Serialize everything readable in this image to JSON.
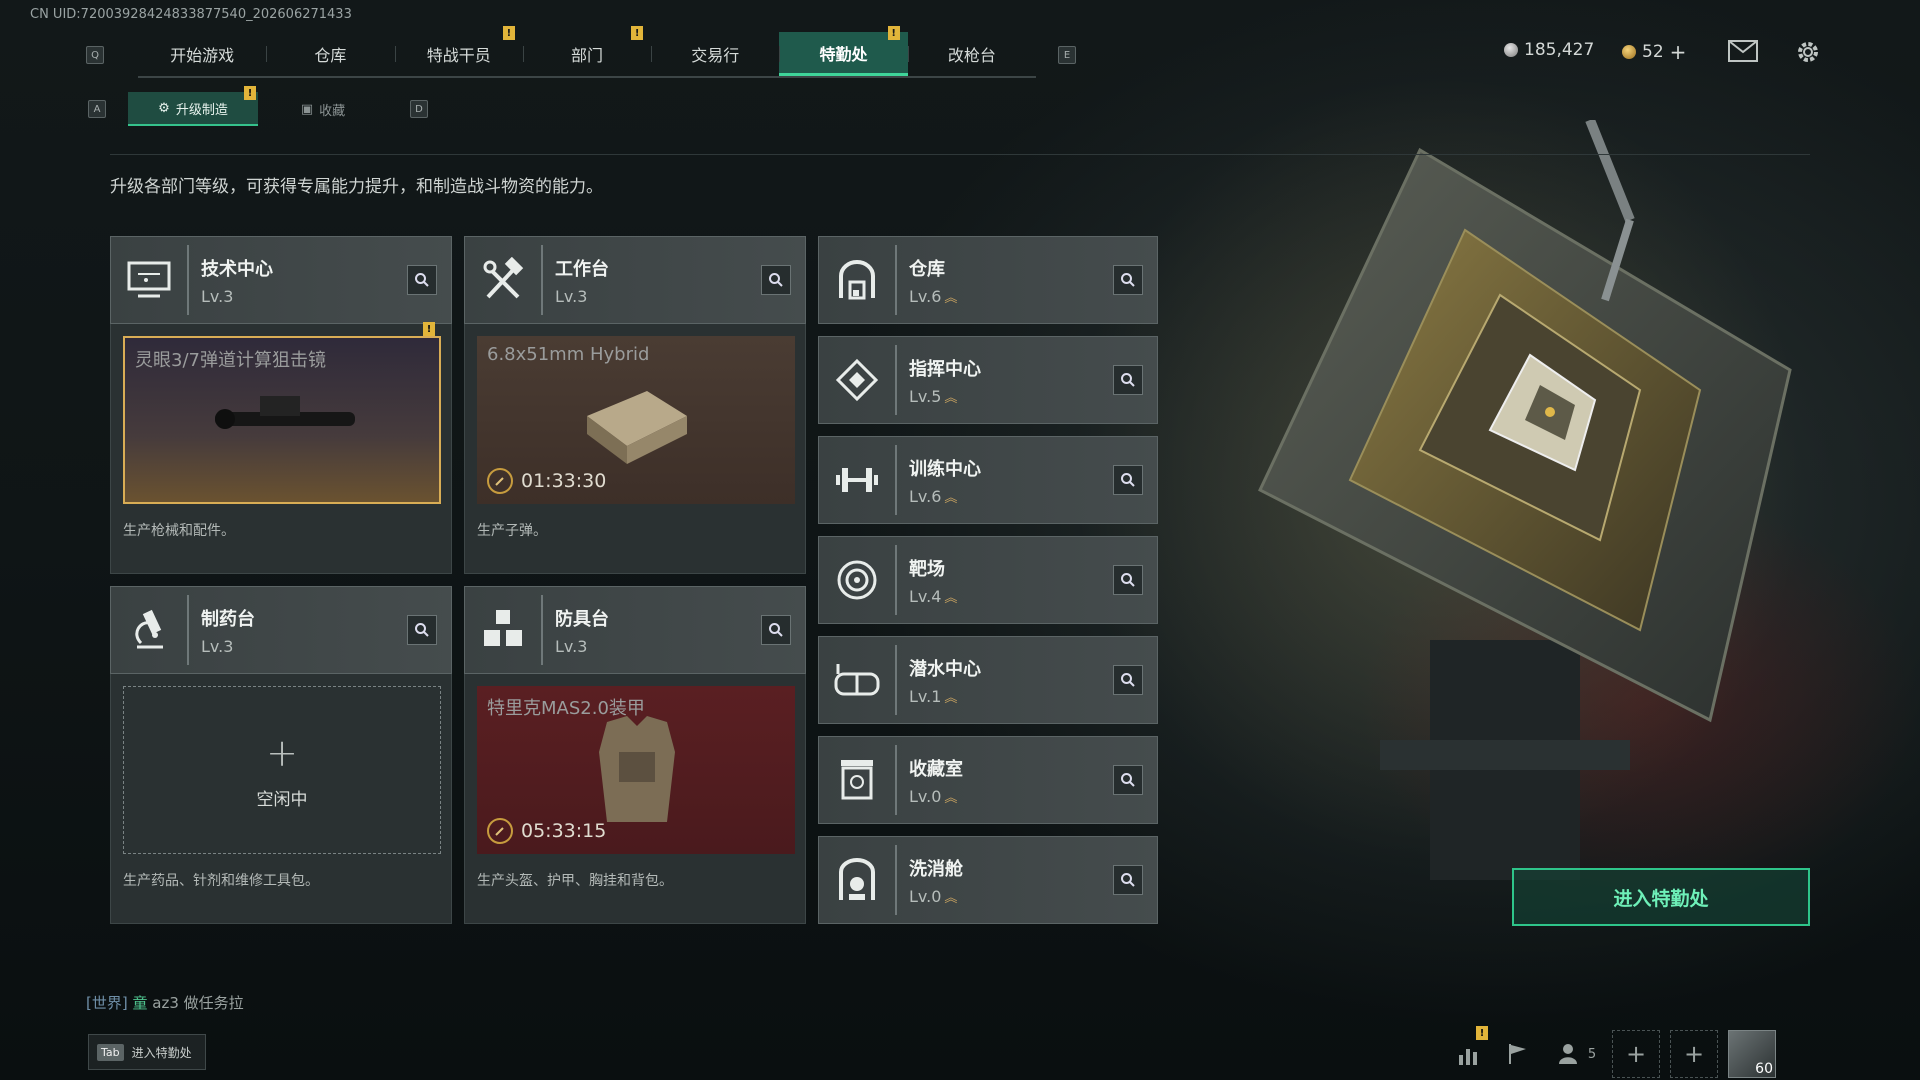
{
  "uid": "CN UID:72003928424833877540_202606271433",
  "nav": {
    "key_left": "Q",
    "key_right": "E",
    "tabs": [
      {
        "label": "开始游戏",
        "warn": false
      },
      {
        "label": "仓库",
        "warn": false
      },
      {
        "label": "特战干员",
        "warn": true
      },
      {
        "label": "部门",
        "warn": true
      },
      {
        "label": "交易行",
        "warn": false
      },
      {
        "label": "特勤处",
        "warn": true,
        "active": true
      },
      {
        "label": "改枪台",
        "warn": false
      }
    ],
    "warn_mark": "!"
  },
  "currency": {
    "silver": "185,427",
    "gold": "52",
    "plus": "+"
  },
  "subtabs": {
    "key_left": "A",
    "key_right": "D",
    "upgrade": "升级制造",
    "collect": "收藏"
  },
  "description": "升级各部门等级，可获得专属能力提升，和制造战斗物资的能力。",
  "workshops": [
    {
      "name": "技术中心",
      "level": "Lv.3",
      "icon": "computer-icon",
      "item": "灵眼3/7弹道计算狙击镜",
      "timer": "",
      "desc": "生产枪械和配件。"
    },
    {
      "name": "工作台",
      "level": "Lv.3",
      "icon": "hammer-wrench-icon",
      "item": "6.8x51mm Hybrid",
      "timer": "01:33:30",
      "desc": "生产子弹。"
    },
    {
      "name": "制药台",
      "level": "Lv.3",
      "icon": "microscope-icon",
      "item": "",
      "idle": "空闲中",
      "timer": "",
      "desc": "生产药品、针剂和维修工具包。"
    },
    {
      "name": "防具台",
      "level": "Lv.3",
      "icon": "cubes-icon",
      "item": "特里克MAS2.0装甲",
      "timer": "05:33:15",
      "desc": "生产头盔、护甲、胸挂和背包。"
    }
  ],
  "facilities": [
    {
      "name": "仓库",
      "level": "Lv.6",
      "icon": "warehouse-icon"
    },
    {
      "name": "指挥中心",
      "level": "Lv.5",
      "icon": "command-icon"
    },
    {
      "name": "训练中心",
      "level": "Lv.6",
      "icon": "dumbbell-icon"
    },
    {
      "name": "靶场",
      "level": "Lv.4",
      "icon": "target-icon"
    },
    {
      "name": "潜水中心",
      "level": "Lv.1",
      "icon": "diving-mask-icon"
    },
    {
      "name": "收藏室",
      "level": "Lv.0",
      "icon": "collection-icon"
    },
    {
      "name": "洗消舱",
      "level": "Lv.0",
      "icon": "decontam-icon"
    }
  ],
  "upgrade_glyph": "︽",
  "enter_button": "进入特勤处",
  "chat": {
    "channel": "[世界]",
    "name": "童",
    "text": "az3 做任务拉"
  },
  "tab_hint": {
    "key": "Tab",
    "label": "进入特勤处"
  },
  "bottom": {
    "friends_count": "5",
    "level": "60"
  },
  "colors": {
    "accent": "#3fd59a",
    "warn": "#e2b53a",
    "timer_ring": "#c79c3e"
  }
}
